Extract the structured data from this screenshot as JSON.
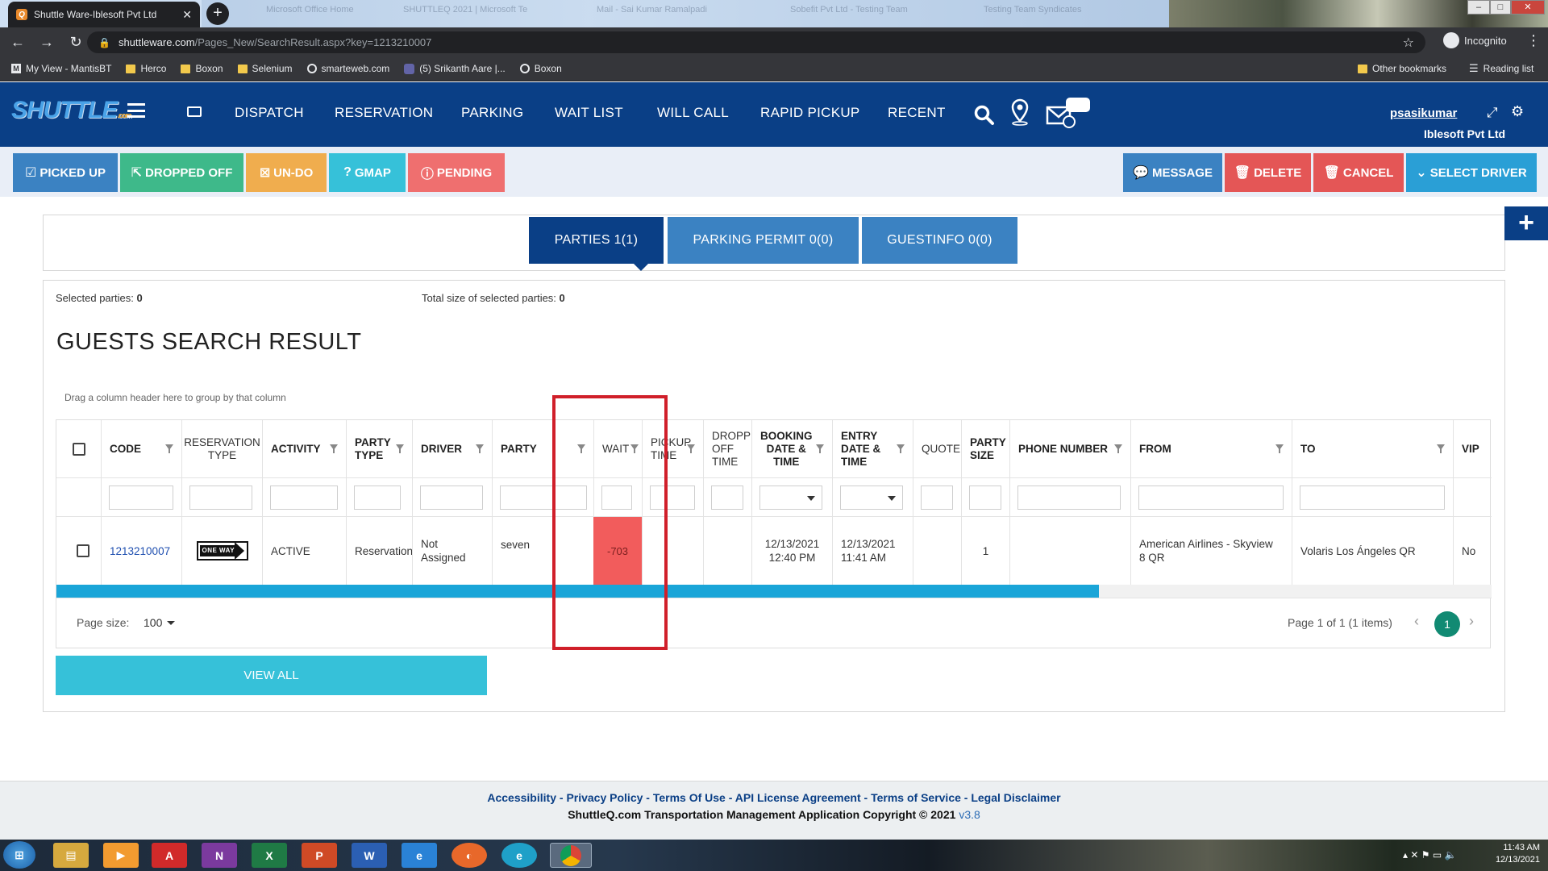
{
  "browser": {
    "active_tab_title": "Shuttle Ware-Iblesoft Pvt Ltd",
    "url_host": "shuttleware.com",
    "url_path": "/Pages_New/SearchResult.aspx?key=1213210007",
    "profile_label": "Incognito",
    "bookmarks": [
      {
        "label": "My View - MantisBT",
        "icon": "mantis-icon"
      },
      {
        "label": "Herco",
        "icon": "folder-icon"
      },
      {
        "label": "Boxon",
        "icon": "folder-icon"
      },
      {
        "label": "Selenium",
        "icon": "folder-icon"
      },
      {
        "label": "smarteweb.com",
        "icon": "globe-icon"
      },
      {
        "label": "(5) Srikanth Aare |...",
        "icon": "teams-icon"
      },
      {
        "label": "Boxon",
        "icon": "globe-icon"
      }
    ],
    "other_bookmarks": "Other bookmarks",
    "reading_list": "Reading list"
  },
  "app": {
    "logo_text": "SHUTTLE",
    "logo_suffix": ".com",
    "menu": [
      "DISPATCH",
      "RESERVATION",
      "PARKING",
      "WAIT LIST",
      "WILL CALL",
      "RAPID PICKUP",
      "RECENT"
    ],
    "username": "psasikumar",
    "company": "Iblesoft Pvt Ltd",
    "colors": {
      "header": "#0a3f86",
      "accent": "#36c1d9",
      "danger": "#e45656",
      "success": "#3eb98a",
      "warning": "#f0ad4e"
    }
  },
  "actions": {
    "left": [
      {
        "label": "PICKED UP",
        "icon": "check-square-icon",
        "color": "#3b82c2"
      },
      {
        "label": "DROPPED OFF",
        "icon": "external-link-icon",
        "color": "#3eb98a"
      },
      {
        "label": "UN-DO",
        "icon": "x-square-icon",
        "color": "#f0ad4e"
      },
      {
        "label": "GMAP",
        "icon": "question-icon",
        "color": "#36c1d9"
      },
      {
        "label": "PENDING",
        "icon": "alert-circle-icon",
        "color": "#ef6f6f"
      }
    ],
    "right": [
      {
        "label": "MESSAGE",
        "icon": "comment-icon",
        "color": "#3b82c2"
      },
      {
        "label": "DELETE",
        "icon": "trash-icon",
        "color": "#e45656"
      },
      {
        "label": "CANCEL",
        "icon": "trash-icon",
        "color": "#e45656"
      },
      {
        "label": "SELECT DRIVER",
        "icon": "chevron-down-icon",
        "color": "#2a9fd6"
      }
    ]
  },
  "tabs": [
    {
      "label": "PARTIES 1(1)",
      "active": true
    },
    {
      "label": "PARKING PERMIT 0(0)",
      "active": false
    },
    {
      "label": "GUESTINFO 0(0)",
      "active": false
    }
  ],
  "results": {
    "selected_parties_label": "Selected parties:",
    "selected_parties_value": "0",
    "total_size_label": "Total size of selected parties:",
    "total_size_value": "0",
    "title": "GUESTS SEARCH RESULT",
    "drag_hint": "Drag a column header here to group by that column",
    "columns": [
      "CODE",
      "RESERVATION TYPE",
      "ACTIVITY",
      "PARTY TYPE",
      "DRIVER",
      "PARTY",
      "WAIT",
      "PICKUP TIME",
      "DROPP OFF TIME",
      "BOOKING DATE & TIME",
      "ENTRY DATE & TIME",
      "QUOTE",
      "PARTY SIZE",
      "PHONE NUMBER",
      "FROM",
      "TO",
      "VIP"
    ],
    "row": {
      "code": "1213210007",
      "reservation_type_badge": "ONE WAY",
      "activity": "ACTIVE",
      "party_type": "Reservation",
      "driver": "Not Assigned",
      "party": "seven",
      "wait": "-703",
      "pickup_time": "",
      "drop_off_time": "",
      "booking_date_time": "12/13/2021 12:40 PM",
      "entry_date_time": "12/13/2021 11:41 AM",
      "quote": "",
      "party_size": "1",
      "phone_number": "",
      "from": "American Airlines - Skyview 8 QR",
      "to": "Volaris Los Ángeles QR",
      "vip": "No"
    },
    "page_size_label": "Page size:",
    "page_size_value": "100",
    "page_info": "Page 1 of 1 (1 items)",
    "current_page": "1",
    "view_all_label": "VIEW ALL"
  },
  "footer": {
    "links": [
      "Accessibility",
      "Privacy Policy",
      "Terms Of Use",
      "API License Agreement",
      "Terms of Service",
      "Legal Disclaimer"
    ],
    "copyright": "ShuttleQ.com Transportation Management Application Copyright © 2021",
    "version": "v3.8"
  },
  "taskbar": {
    "time": "11:43 AM",
    "date": "12/13/2021",
    "apps": [
      "start-orb-icon",
      "file-explorer-icon",
      "media-player-icon",
      "acrobat-icon",
      "onenote-icon",
      "excel-icon",
      "powerpoint-icon",
      "word-icon",
      "internet-explorer-icon",
      "firefox-icon",
      "edge-icon",
      "chrome-icon"
    ]
  }
}
